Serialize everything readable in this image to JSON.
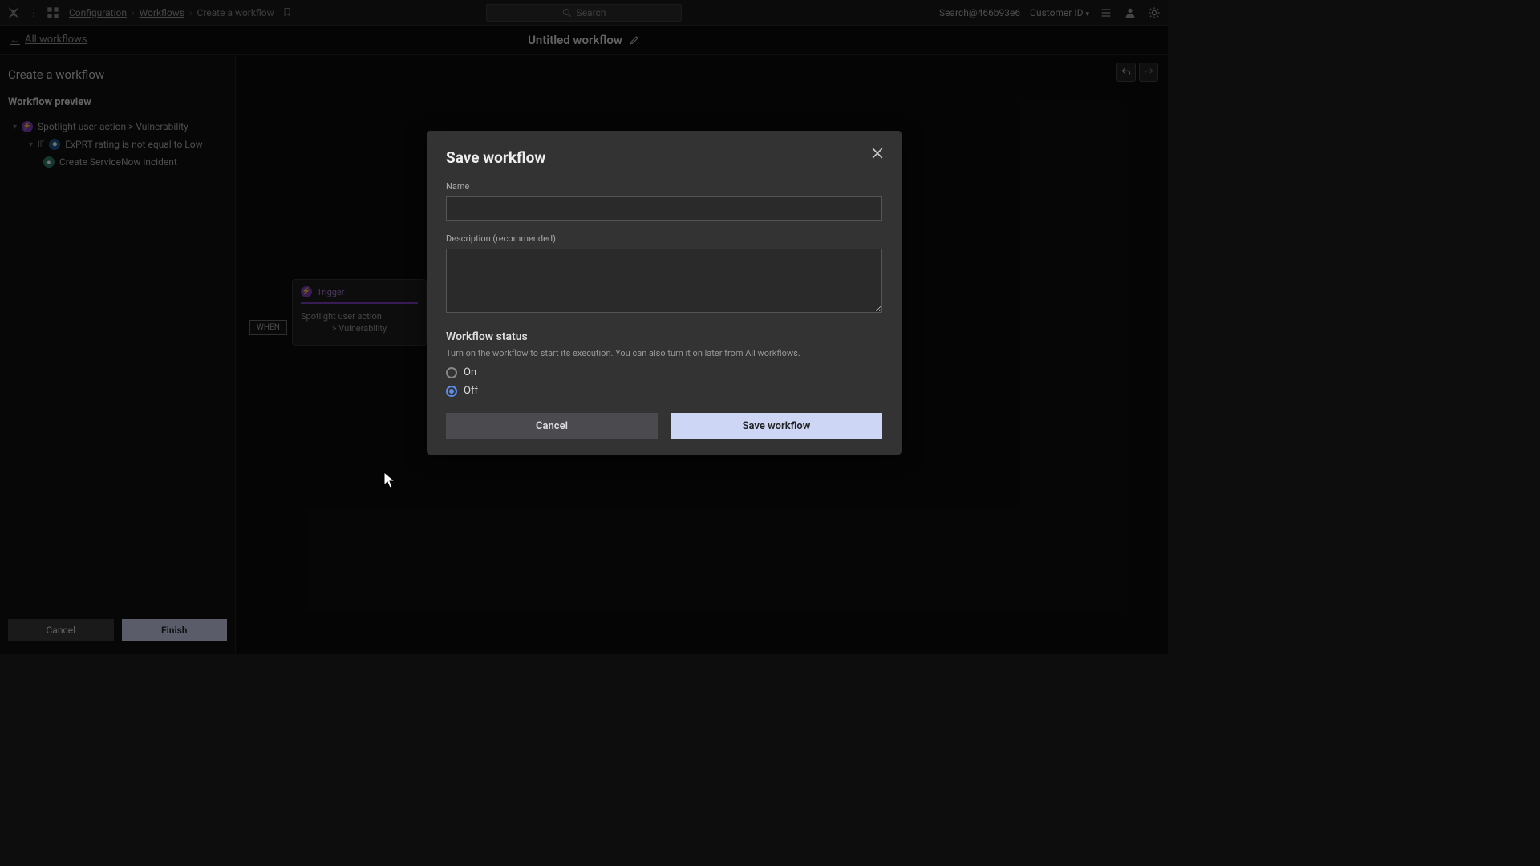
{
  "topbar": {
    "breadcrumb": {
      "configuration": "Configuration",
      "workflows": "Workflows",
      "current": "Create a workflow"
    },
    "search_placeholder": "Search",
    "account": "Search@466b93e6",
    "customer_label": "Customer ID"
  },
  "subheader": {
    "back_label": "All workflows",
    "title": "Untitled workflow"
  },
  "sidebar": {
    "heading": "Create a workflow",
    "preview_heading": "Workflow preview",
    "trigger": "Spotlight user action > Vulnerability",
    "if_label": "IF",
    "condition": "ExPRT rating is not equal to Low",
    "action": "Create ServiceNow incident",
    "cancel": "Cancel",
    "finish": "Finish"
  },
  "canvas": {
    "node_label": "Trigger",
    "when_badge": "WHEN",
    "node_body_line1": "Spotlight user action",
    "node_body_line2": "> Vulnerability"
  },
  "modal": {
    "title": "Save workflow",
    "name_label": "Name",
    "desc_label": "Description (recommended)",
    "status_title": "Workflow status",
    "status_hint": "Turn on the workflow to start its execution. You can also turn it on later from All workflows.",
    "on_label": "On",
    "off_label": "Off",
    "cancel": "Cancel",
    "save": "Save workflow"
  }
}
